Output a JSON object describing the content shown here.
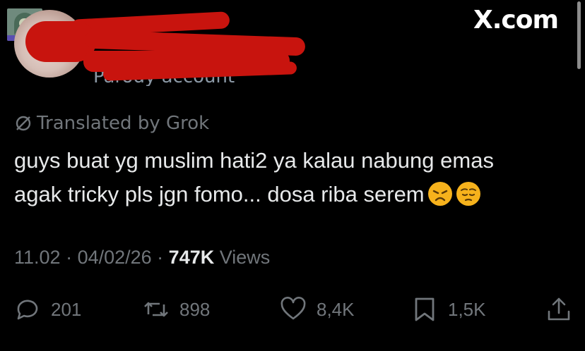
{
  "header": {
    "brand": "X.com",
    "account_fragment": "Parody account"
  },
  "tweet": {
    "translated_label": "Translated by Grok",
    "line1": "guys buat yg muslim hati2 ya kalau nabung emas",
    "line2": "agak tricky pls jgn fomo... dosa riba serem",
    "emojis": [
      "disappointed-face",
      "pensive-face"
    ],
    "time": "11.02",
    "separator": " · ",
    "date": "04/02/26",
    "views_count": "747K",
    "views_label": "Views"
  },
  "actions": {
    "replies": "201",
    "reposts": "898",
    "likes": "8,4K",
    "bookmarks": "1,5K"
  },
  "colors": {
    "background": "#000000",
    "text": "#e7e9ea",
    "muted": "#71767b",
    "redaction": "#c8140e"
  }
}
